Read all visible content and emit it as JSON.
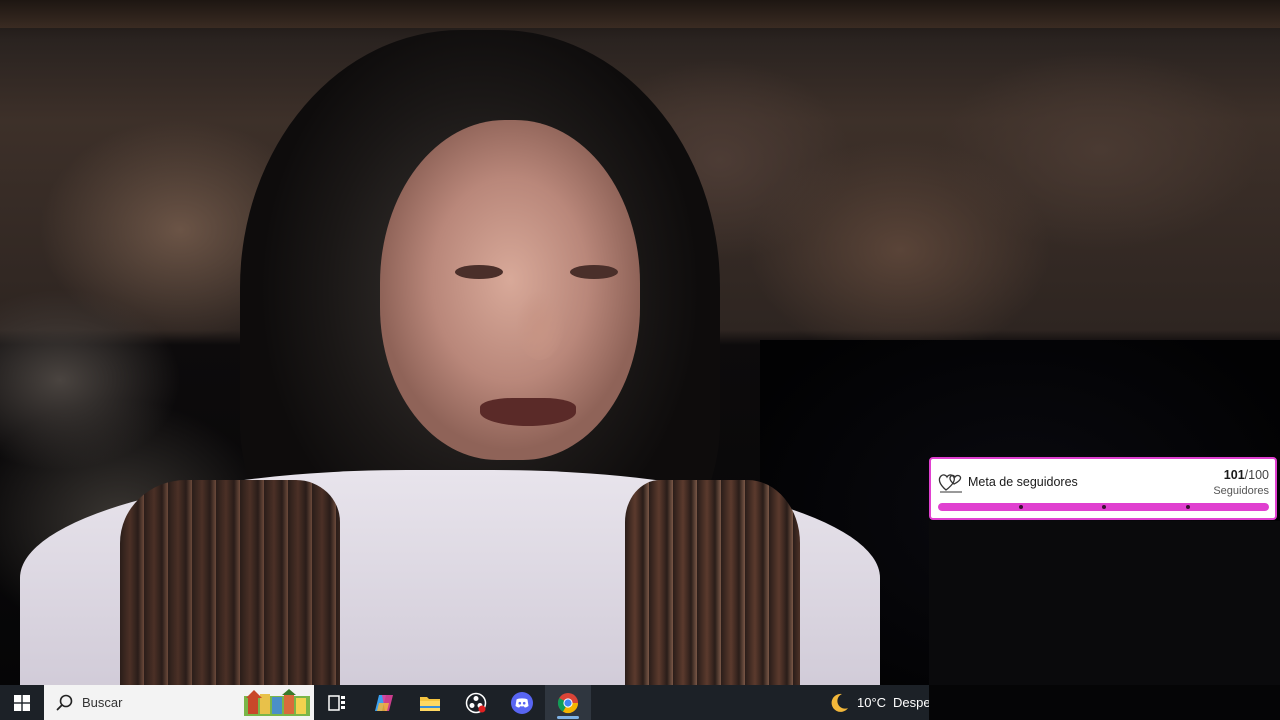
{
  "goal_widget": {
    "title": "Meta de seguidores",
    "current": "101",
    "separator": "/",
    "target": "100",
    "unit": "Seguidores",
    "progress_fraction": 1.0,
    "accent_color": "#e040d0"
  },
  "taskbar": {
    "search_placeholder": "Buscar",
    "pinned_apps": [
      {
        "name": "task-view",
        "icon": "task-view-icon"
      },
      {
        "name": "copilot",
        "icon": "copilot-icon"
      },
      {
        "name": "file-explorer",
        "icon": "folder-icon"
      },
      {
        "name": "obs-studio",
        "icon": "obs-icon"
      },
      {
        "name": "discord",
        "icon": "discord-icon"
      },
      {
        "name": "chrome",
        "icon": "chrome-icon",
        "active": true
      }
    ],
    "weather": {
      "temperature": "10°C",
      "condition": "Despe",
      "icon": "moon-icon"
    }
  }
}
